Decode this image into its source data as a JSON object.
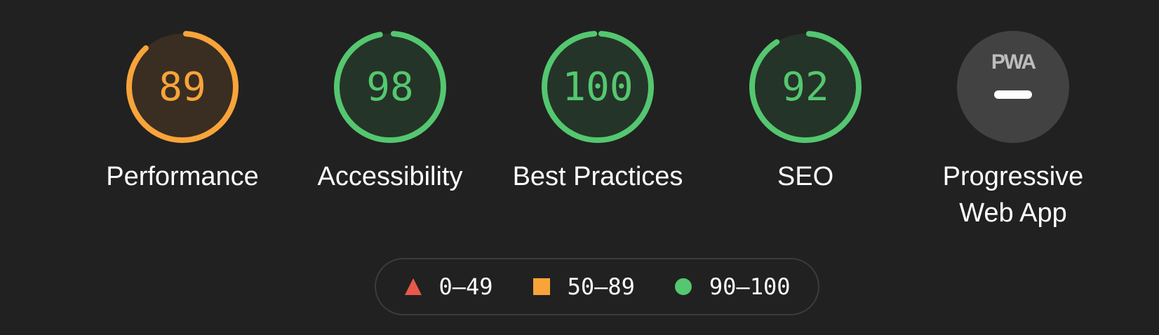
{
  "colors": {
    "background": "#212121",
    "orange": "#f8a43a",
    "green": "#54c770",
    "red": "#e8594a",
    "orange_fill": "#3a2e22",
    "green_fill": "#253428",
    "gray_fill": "#424242"
  },
  "gauges": [
    {
      "score": "89",
      "label": "Performance",
      "color": "orange",
      "fraction": 0.89
    },
    {
      "score": "98",
      "label": "Accessibility",
      "color": "green",
      "fraction": 0.98
    },
    {
      "score": "100",
      "label": "Best Practices",
      "color": "green",
      "fraction": 1.0
    },
    {
      "score": "92",
      "label": "SEO",
      "color": "green",
      "fraction": 0.92
    }
  ],
  "pwa": {
    "badge_text": "PWA",
    "label_line1": "Progressive",
    "label_line2": "Web App"
  },
  "legend": [
    {
      "icon": "triangle-icon",
      "range": "0–49",
      "color": "red"
    },
    {
      "icon": "square-icon",
      "range": "50–89",
      "color": "orange"
    },
    {
      "icon": "circle-icon",
      "range": "90–100",
      "color": "green"
    }
  ]
}
